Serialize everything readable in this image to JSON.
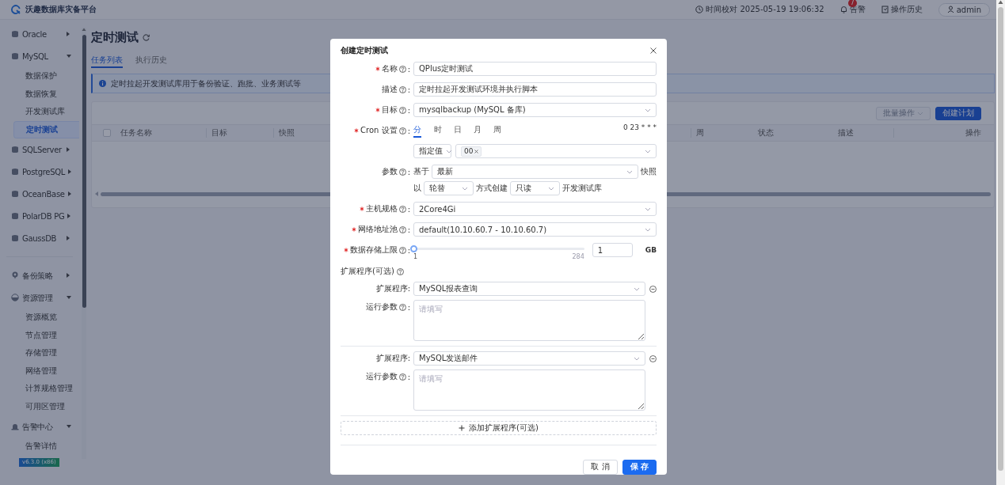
{
  "header": {
    "title": "沃趣数据库灾备平台",
    "clock": "时间校对 2025-05-19 19:06:32",
    "alerts": {
      "label": "告警",
      "count": "7"
    },
    "history": "操作历史",
    "user": "admin"
  },
  "sidebar": {
    "sections": [
      {
        "groups": [
          {
            "label": "Oracle",
            "kind": "database",
            "expanded": false
          },
          {
            "label": "MySQL",
            "kind": "database",
            "expanded": true,
            "children": [
              {
                "label": "数据保护",
                "selected": false
              },
              {
                "label": "数据恢复",
                "selected": false
              },
              {
                "label": "开发测试库",
                "selected": false
              },
              {
                "label": "定时测试",
                "selected": true
              }
            ]
          },
          {
            "label": "SQLServer",
            "kind": "database",
            "expanded": false
          },
          {
            "label": "PostgreSQL",
            "kind": "database",
            "expanded": false
          },
          {
            "label": "OceanBase",
            "kind": "database",
            "expanded": false
          },
          {
            "label": "PolarDB PG",
            "kind": "database",
            "expanded": false
          },
          {
            "label": "GaussDB",
            "kind": "database",
            "expanded": false
          }
        ]
      },
      {
        "groups": [
          {
            "label": "备份策略",
            "kind": "strategy",
            "expanded": false
          },
          {
            "label": "资源管理",
            "kind": "resource",
            "expanded": true,
            "children": [
              {
                "label": "资源概览",
                "selected": false
              },
              {
                "label": "节点管理",
                "selected": false
              },
              {
                "label": "存储管理",
                "selected": false
              },
              {
                "label": "网络管理",
                "selected": false
              },
              {
                "label": "计算规格管理",
                "selected": false
              },
              {
                "label": "可用区管理",
                "selected": false
              }
            ]
          },
          {
            "label": "告警中心",
            "kind": "alert",
            "expanded": true,
            "children": [
              {
                "label": "告警详情",
                "selected": false
              }
            ]
          }
        ]
      }
    ],
    "version": "v6.3.0 (x86)"
  },
  "page": {
    "title": "定时测试",
    "tabs": [
      {
        "label": "任务列表",
        "selected": true
      },
      {
        "label": "执行历史",
        "selected": false
      }
    ],
    "notice": "定时拉起开发测试库用于备份验证、跑批、业务测试等",
    "toolbar": {
      "batch": {
        "label": "批量操作",
        "disabled": true
      },
      "create": "创建计划"
    },
    "table": {
      "select_all": {
        "checked": false
      },
      "columns": [
        "任务名称",
        "目标",
        "快照",
        "周",
        "状态",
        "描述",
        "操作"
      ]
    }
  },
  "dialog": {
    "title": "创建定时测试",
    "fields": [
      {
        "kind": "input",
        "label": "名称",
        "required": true,
        "help": true,
        "suffix": ":",
        "value": "QPlus定时测试"
      },
      {
        "kind": "input",
        "label": "描述",
        "required": false,
        "help": true,
        "suffix": ":",
        "value": "定时拉起开发测试环境并执行脚本"
      },
      {
        "kind": "select",
        "label": "目标",
        "required": true,
        "help": true,
        "suffix": ":",
        "value": "mysqlbackup (MySQL 备库)"
      },
      {
        "kind": "cron",
        "label": "Cron 设置",
        "required": true,
        "help": true,
        "suffix": ":",
        "tabs": [
          {
            "label": "分",
            "selected": true
          },
          {
            "label": "时",
            "selected": false
          },
          {
            "label": "日",
            "selected": false
          },
          {
            "label": "月",
            "selected": false
          },
          {
            "label": "周",
            "selected": false
          }
        ],
        "expression": "0 23 * * *",
        "mode": "指定值",
        "tags": [
          "00"
        ]
      },
      {
        "kind": "params",
        "label": "参数",
        "required": false,
        "help": true,
        "suffix": ":",
        "lines": [
          [
            {
              "kind": "text",
              "text": "基于"
            },
            {
              "kind": "select",
              "value": "最新"
            },
            {
              "kind": "text",
              "text": "快照"
            }
          ],
          [
            {
              "kind": "text",
              "text": "以"
            },
            {
              "kind": "select",
              "value": "轮替"
            },
            {
              "kind": "text",
              "text": "方式创建"
            },
            {
              "kind": "select",
              "value": "只读"
            },
            {
              "kind": "text",
              "text": "开发测试库"
            }
          ]
        ]
      },
      {
        "kind": "select",
        "label": "主机规格",
        "required": true,
        "help": true,
        "suffix": ":",
        "value": "2Core4Gi"
      },
      {
        "kind": "select",
        "label": "网络地址池",
        "required": true,
        "help": true,
        "suffix": ":",
        "value": "default(10.10.60.7 - 10.10.60.7)"
      },
      {
        "kind": "slider",
        "label": "数据存储上限",
        "required": true,
        "help": true,
        "suffix": ":",
        "level": 0,
        "min": "1",
        "max": "284",
        "value": "1",
        "unit": "GB"
      }
    ],
    "extensions_title": "扩展程序(可选)",
    "extensions": [
      {
        "label": "扩展程序:",
        "value": "MySQL报表查询",
        "params_label": "运行参数",
        "params_suffix": ":",
        "placeholder": "请填写"
      },
      {
        "label": "扩展程序:",
        "value": "MySQL发送邮件",
        "params_label": "运行参数",
        "params_suffix": ":",
        "placeholder": "请填写"
      }
    ],
    "add_label": "添加扩展程序(可选)",
    "buttons": [
      {
        "label": "取 消",
        "kind": "default"
      },
      {
        "label": "保 存",
        "kind": "primary"
      }
    ]
  }
}
